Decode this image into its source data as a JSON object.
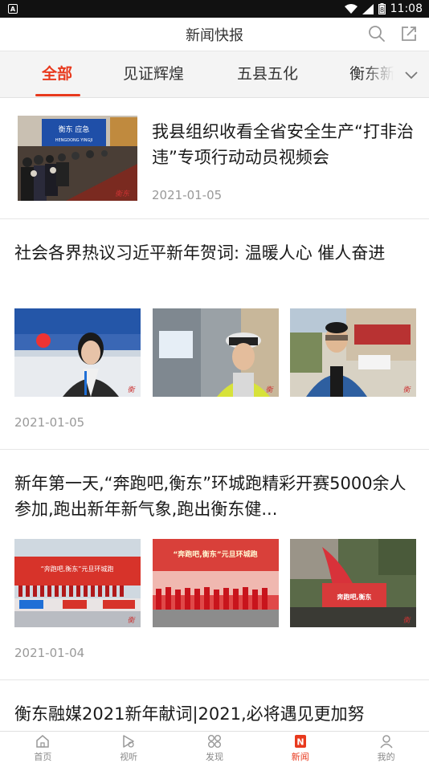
{
  "status_bar": {
    "time": "11:08",
    "battery": "8"
  },
  "header": {
    "title": "新闻快报"
  },
  "tabs": [
    {
      "label": "全部",
      "active": true
    },
    {
      "label": "见证辉煌",
      "active": false
    },
    {
      "label": "五县五化",
      "active": false
    },
    {
      "label": "衡东新",
      "active": false
    }
  ],
  "feed": [
    {
      "headline": "我县组织收看全省安全生产“打非治违”专项行动动员视频会",
      "date": "2021-01-05",
      "thumb_text": "衡东 应急",
      "thumb_text2": "HENGDONG YINGJI"
    },
    {
      "headline": "社会各界热议习近平新年贺词:  温暖人心  催人奋进",
      "date": "2021-01-05"
    },
    {
      "headline": "新年第一天,“奔跑吧,衡东”环城跑精彩开赛5000余人参加,跑出新年新气象,跑出衡东健...",
      "date": "2021-01-04",
      "banner_text": "“奔跑吧,衡东”元旦环城跑",
      "banner_text2": "奔跑吧,衡东"
    },
    {
      "headline": "衡东融媒2021新年献词|2021,必将遇见更加努"
    }
  ],
  "bottom_nav": [
    {
      "label": "首页",
      "icon": "home-icon",
      "active": false
    },
    {
      "label": "视听",
      "icon": "video-icon",
      "active": false
    },
    {
      "label": "发现",
      "icon": "discover-icon",
      "active": false
    },
    {
      "label": "新闻",
      "icon": "news-icon",
      "active": true
    },
    {
      "label": "我的",
      "icon": "profile-icon",
      "active": false
    }
  ],
  "colors": {
    "accent": "#e8391d"
  }
}
